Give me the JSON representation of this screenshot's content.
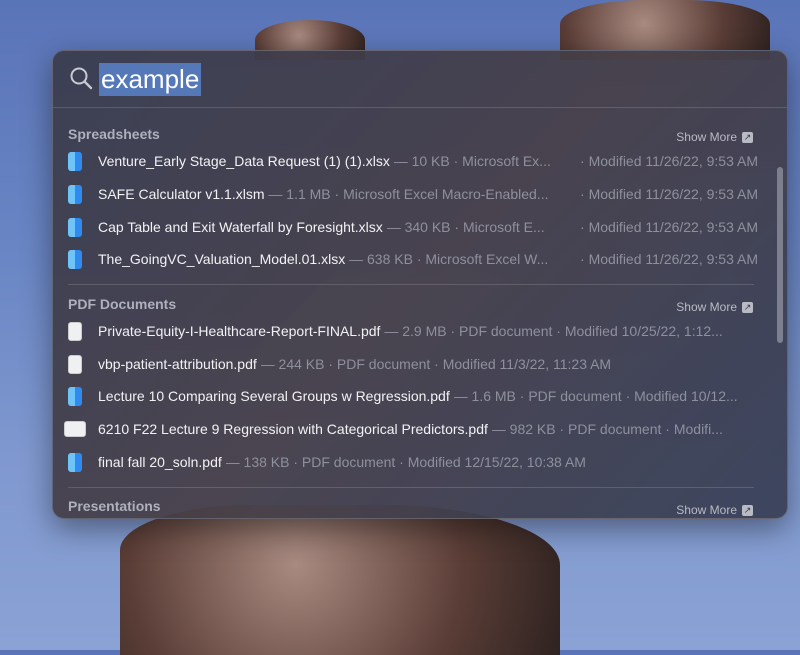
{
  "search": {
    "query": "example"
  },
  "sections": [
    {
      "title": "Spreadsheets",
      "show_more": "Show More",
      "items": [
        {
          "name": "Venture_Early Stage_Data Request (1) (1).xlsx",
          "meta": "— 10 KB · Microsoft Ex...",
          "modified": "· Modified 11/26/22, 9:53 AM",
          "icon": "finder"
        },
        {
          "name": "SAFE Calculator v1.1.xlsm",
          "meta": "— 1.1 MB · Microsoft Excel Macro-Enabled...",
          "modified": "· Modified 11/26/22, 9:53 AM",
          "icon": "finder"
        },
        {
          "name": "Cap Table and Exit Waterfall by Foresight.xlsx",
          "meta": "— 340 KB · Microsoft E...",
          "modified": "· Modified 11/26/22, 9:53 AM",
          "icon": "finder"
        },
        {
          "name": "The_GoingVC_Valuation_Model.01.xlsx",
          "meta": "— 638 KB · Microsoft Excel W...",
          "modified": "· Modified 11/26/22, 9:53 AM",
          "icon": "finder"
        }
      ]
    },
    {
      "title": "PDF Documents",
      "show_more": "Show More",
      "items": [
        {
          "name": "Private-Equity-I-Healthcare-Report-FINAL.pdf",
          "meta": "— 2.9 MB · PDF document · Modified 10/25/22, 1:12...",
          "icon": "document"
        },
        {
          "name": "vbp-patient-attribution.pdf",
          "meta": "— 244 KB · PDF document · Modified 11/3/22, 11:23 AM",
          "icon": "document"
        },
        {
          "name": "Lecture 10 Comparing Several Groups w Regression.pdf",
          "meta": "— 1.6 MB · PDF document · Modified 10/12...",
          "icon": "finder"
        },
        {
          "name": "6210 F22 Lecture 9 Regression with Categorical Predictors.pdf",
          "meta": "— 982 KB · PDF document · Modifi...",
          "icon": "document-landscape"
        },
        {
          "name": "final fall 20_soln.pdf",
          "meta": "— 138 KB · PDF document · Modified 12/15/22, 10:38 AM",
          "icon": "finder"
        }
      ]
    },
    {
      "title": "Presentations",
      "show_more": "Show More",
      "items": []
    }
  ]
}
